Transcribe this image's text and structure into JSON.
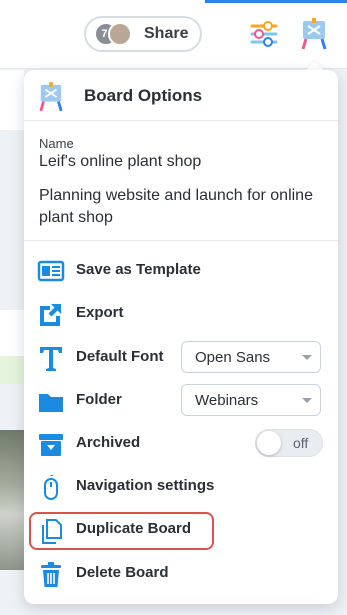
{
  "topbar": {
    "share_label": "Share",
    "avatar_initial": "7."
  },
  "panel": {
    "title": "Board Options",
    "name_label": "Name",
    "name_value": "Leif's online plant shop",
    "description": "Planning website and launch for online plant shop",
    "items": [
      {
        "label": "Save as Template",
        "icon": "template-icon"
      },
      {
        "label": "Export",
        "icon": "export-icon"
      },
      {
        "label": "Default Font",
        "icon": "font-icon",
        "value": "Open Sans"
      },
      {
        "label": "Folder",
        "icon": "folder-icon",
        "value": "Webinars"
      },
      {
        "label": "Archived",
        "icon": "archive-icon",
        "toggle": "off"
      },
      {
        "label": "Navigation settings",
        "icon": "mouse-icon"
      },
      {
        "label": "Duplicate Board",
        "icon": "duplicate-icon"
      },
      {
        "label": "Delete Board",
        "icon": "trash-icon"
      }
    ]
  },
  "colors": {
    "icon_blue": "#1a8be0",
    "highlight_red": "#d9534f",
    "accent_blue": "#2f80ed"
  }
}
